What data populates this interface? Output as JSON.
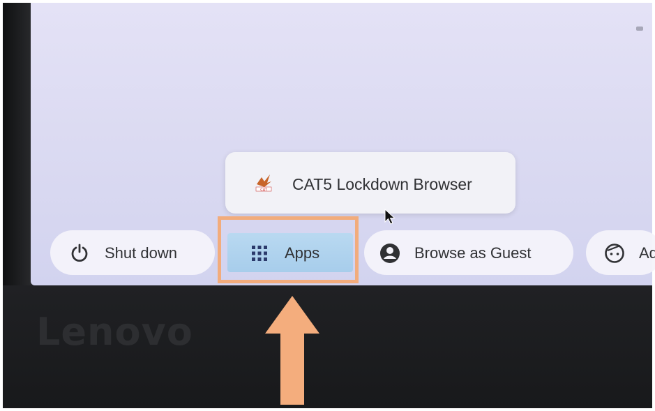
{
  "laptop": {
    "brand": "Lenovo"
  },
  "context_menu": {
    "items": [
      {
        "label": "CAT5 Lockdown Browser",
        "icon": "cat5-app-icon"
      }
    ]
  },
  "shelf": {
    "shutdown_label": "Shut down",
    "apps_label": "Apps",
    "guest_label": "Browse as Guest",
    "add_label": "Ad"
  },
  "annotation": {
    "highlight_color": "#f2ac7c",
    "arrow_color": "#f4ad7d",
    "highlight_target": "Apps"
  },
  "colors": {
    "screen_bg": "#dcdbf2",
    "pill_bg": "#f4f3fa",
    "apps_highlight": "#b3d5ef",
    "text": "#303134"
  }
}
